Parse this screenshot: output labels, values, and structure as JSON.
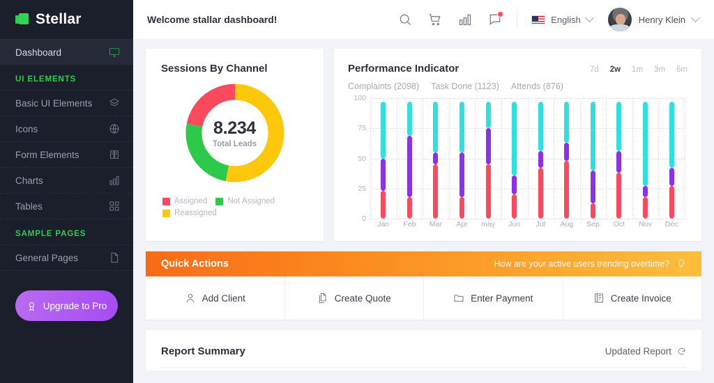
{
  "brand": {
    "name": "Stellar",
    "logo_icon": "stellar-logo-icon"
  },
  "sidebar": {
    "dashboard": {
      "label": "Dashboard",
      "icon": "monitor-icon"
    },
    "section_ui": "UI ELEMENTS",
    "items": [
      {
        "label": "Basic UI Elements",
        "icon": "layers-icon"
      },
      {
        "label": "Icons",
        "icon": "globe-icon"
      },
      {
        "label": "Form Elements",
        "icon": "book-icon"
      },
      {
        "label": "Charts",
        "icon": "bar-chart-icon"
      },
      {
        "label": "Tables",
        "icon": "grid-icon"
      }
    ],
    "section_pages": "SAMPLE PAGES",
    "pages": [
      {
        "label": "General Pages",
        "icon": "file-icon"
      }
    ],
    "upgrade": {
      "label": "Upgrade to Pro",
      "icon": "award-icon"
    }
  },
  "topbar": {
    "welcome": "Welcome stallar dashboard!",
    "icons": [
      "search-icon",
      "cart-icon",
      "bar-chart-icon",
      "message-icon"
    ],
    "notification_badge": true,
    "language": {
      "label": "English",
      "flag": "us-flag-icon"
    },
    "user": {
      "name": "Henry Klein",
      "avatar": "user-avatar"
    }
  },
  "sessions_card": {
    "title": "Sessions By Channel",
    "total_value": "8.234",
    "total_label": "Total Leads"
  },
  "performance_card": {
    "title": "Performance Indicator",
    "ranges": [
      "7d",
      "2w",
      "1m",
      "3m",
      "6m"
    ],
    "active_range": "2w",
    "series_labels": [
      "Complaints (2098)",
      "Task Done (1123)",
      "Attends (876)"
    ]
  },
  "quick_actions": {
    "title": "Quick Actions",
    "note": "How are your active users trending overtime?",
    "note_icon": "lightbulb-icon",
    "items": [
      {
        "label": "Add Client",
        "icon": "user-icon"
      },
      {
        "label": "Create Quote",
        "icon": "copy-icon"
      },
      {
        "label": "Enter Payment",
        "icon": "folder-icon"
      },
      {
        "label": "Create Invoice",
        "icon": "invoice-icon"
      }
    ]
  },
  "report": {
    "title": "Report Summary",
    "updated_label": "Updated Report",
    "refresh_icon": "refresh-icon"
  },
  "colors": {
    "sidebar_bg": "#1b1e2b",
    "accent_green": "#2ecc4f",
    "assigned_red": "#fb4a5e",
    "not_assigned_green": "#2cc94b",
    "reassigned_yellow": "#fdc70c",
    "complaints_red": "#fb4a5e",
    "task_purple": "#8b31e8",
    "attends_cyan": "#2ee0e0",
    "qa_gradient_start": "#f86c18",
    "qa_gradient_end": "#fdbe3c",
    "upgrade_purple": "#a64bf4"
  },
  "chart_data": [
    {
      "type": "pie",
      "title": "Sessions By Channel",
      "center_value": "8.234",
      "center_label": "Total Leads",
      "legend_position": "bottom",
      "labels": [
        "Assigned",
        "Not Assigned",
        "Reassigned"
      ],
      "values": [
        22,
        25,
        53
      ],
      "colors": [
        "#fb4a5e",
        "#2cc94b",
        "#fdc70c"
      ]
    },
    {
      "type": "bar",
      "title": "Performance Indicator",
      "xlabel": "",
      "ylabel": "",
      "ylim": [
        0,
        100
      ],
      "yticks": [
        0,
        25,
        50,
        75,
        100
      ],
      "grid": true,
      "stacked": true,
      "legend_position": "top",
      "categories": [
        "Jan",
        "Feb",
        "Mar",
        "Apr",
        "may",
        "Jun",
        "Jul",
        "Aug",
        "Sep",
        "Oct",
        "Nov",
        "Dec"
      ],
      "series": [
        {
          "name": "Complaints (2098)",
          "color": "#fb4a5e",
          "values": [
            23,
            18,
            45,
            18,
            45,
            20,
            42,
            48,
            13,
            38,
            18,
            27
          ]
        },
        {
          "name": "Task Done (1123)",
          "color": "#8b31e8",
          "values": [
            27,
            51,
            10,
            37,
            30,
            16,
            14,
            15,
            27,
            18,
            9,
            15
          ]
        },
        {
          "name": "Attends (876)",
          "color": "#2ee0e0",
          "values": [
            47,
            28,
            42,
            42,
            22,
            61,
            41,
            34,
            57,
            41,
            70,
            55
          ]
        }
      ]
    }
  ]
}
